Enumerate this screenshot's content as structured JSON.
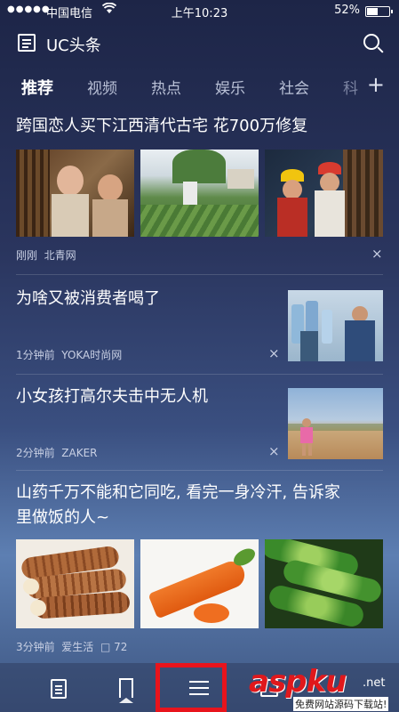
{
  "status_bar": {
    "signal": "●●●●●",
    "carrier": "中国电信",
    "time": "上午10:23",
    "battery": "52%"
  },
  "header": {
    "title": "UC头条"
  },
  "tabs": [
    "推荐",
    "视频",
    "热点",
    "娱乐",
    "社会",
    "科"
  ],
  "news": [
    {
      "title": "跨国恋人买下江西清代古宅 花700万修复",
      "time": "刚刚",
      "source": "北青网",
      "dismiss": "×"
    },
    {
      "title": "为啥又被消费者喝了",
      "time": "1分钟前",
      "source": "YOKA时尚网",
      "dismiss": "×"
    },
    {
      "title": "小女孩打高尔夫击中无人机",
      "time": "2分钟前",
      "source": "ZAKER",
      "dismiss": "×"
    },
    {
      "title_line1": "山药千万不能和它同吃, 看完一身冷汗, 告诉家",
      "title_line2": "里做饭的人~",
      "time": "3分钟前",
      "source": "爱生活",
      "comments": "72",
      "dismiss": "×"
    }
  ],
  "watermark": {
    "main": "aspku",
    "net": ".net",
    "sub": "免费网站源码下载站!"
  },
  "colors": {
    "highlight": "#e8141c",
    "watermark_red": "#e0181c"
  }
}
